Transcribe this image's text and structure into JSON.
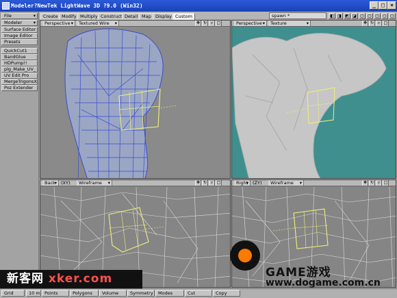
{
  "window": {
    "title": "Modeler?NewTek LightWave 3D ?9.0 (Win32)"
  },
  "left_panel": {
    "file": "File",
    "modeler": "Modeler",
    "surface_editor": "Surface Editor",
    "image_editor": "Image Editor",
    "presets": "Presets",
    "plugins": [
      "QuickCut1",
      "BandGlue",
      "HDPump!!",
      "plg_Make_UV_",
      "UV Edit Pro",
      "MergeTrigonsX",
      "Poz Extender"
    ]
  },
  "tabs": [
    "Create",
    "Modify",
    "Multiply",
    "Construct",
    "Detail",
    "Map",
    "Display",
    "Custom"
  ],
  "active_tab": "Custom",
  "object_field": {
    "value": "spawn *"
  },
  "viewports": {
    "top_left": {
      "view": "Perspective",
      "mode": "Textured Wire"
    },
    "top_right": {
      "view": "Perspective",
      "mode": "Texture"
    },
    "bottom_left": {
      "view": "Back",
      "axes": "(XY)",
      "mode": "Wireframe"
    },
    "bottom_right": {
      "view": "Right",
      "axes": "(ZY)",
      "mode": "Wireframe"
    }
  },
  "bottom_bar": {
    "grid": "Grid",
    "grid_value": "10 m",
    "points": "Points",
    "polygons": "Polygons",
    "volume": "Volume",
    "symmetry": "Symmetry",
    "modes": "Modes",
    "cut": "Cut",
    "copy": "Copy"
  },
  "watermarks": {
    "left_cn": "新客网",
    "left_en": "xker.com",
    "right_title": "GAME游戏",
    "right_url": "www.dogame.com.cn"
  },
  "colors": {
    "viewport_bg": "#8a8a8a",
    "textured_bg": "#3f8f8f",
    "wire_blue": "#3b4bd1",
    "selection_yellow": "#f0f07a",
    "active_tab": "#f2f2f2"
  }
}
